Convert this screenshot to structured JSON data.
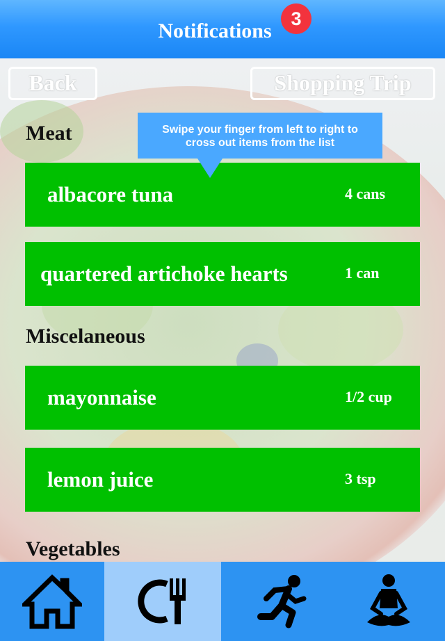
{
  "header": {
    "title": "Notifications",
    "badge_count": "3"
  },
  "buttons": {
    "back_label": "Back",
    "shopping_trip_label": "Shopping Trip"
  },
  "tooltip": {
    "line1": "Swipe your finger from left to right to",
    "line2": "cross out items from the list"
  },
  "sections": [
    {
      "title": "Meat",
      "items": [
        {
          "name": "albacore tuna",
          "qty": "4 cans"
        },
        {
          "name": "quartered artichoke hearts",
          "qty": "1 can"
        }
      ]
    },
    {
      "title": "Miscelaneous",
      "items": [
        {
          "name": "mayonnaise",
          "qty": "1/2 cup"
        },
        {
          "name": "lemon juice",
          "qty": "3 tsp"
        }
      ]
    },
    {
      "title": "Vegetables",
      "items": []
    }
  ],
  "tabs": [
    {
      "icon": "home-icon",
      "active": false
    },
    {
      "icon": "plate-fork-icon",
      "active": true
    },
    {
      "icon": "running-man-icon",
      "active": false
    },
    {
      "icon": "meditation-icon",
      "active": false
    }
  ],
  "colors": {
    "header_blue": "#2f98ff",
    "item_green": "#00c000",
    "badge_red": "#f2333d",
    "tooltip_blue": "#4aa8ff",
    "tabbar_blue": "#2d93f2",
    "tab_active": "#9fcdfb"
  }
}
